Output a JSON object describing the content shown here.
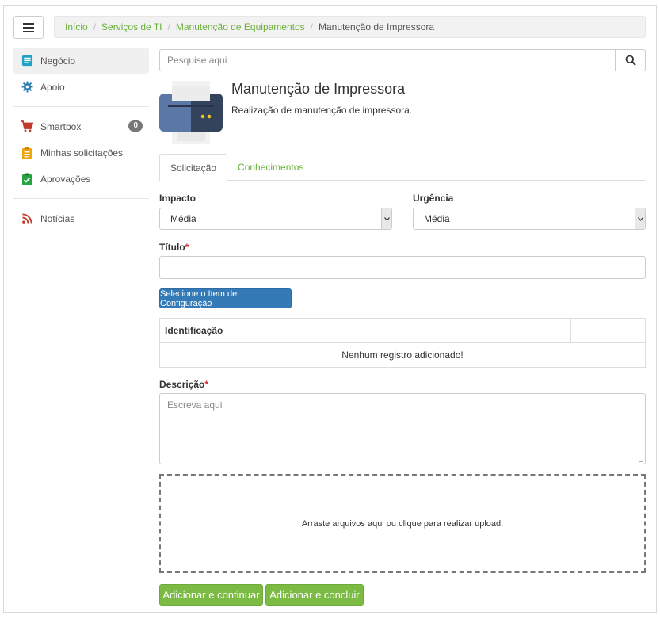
{
  "breadcrumb": {
    "items": [
      "Início",
      "Serviços de TI",
      "Manutenção de Equipamentos"
    ],
    "current": "Manutenção de Impressora"
  },
  "sidebar": {
    "items": [
      {
        "label": "Negócio",
        "icon": "newspaper-icon"
      },
      {
        "label": "Apoio",
        "icon": "gear-icon"
      },
      {
        "label": "Smartbox",
        "icon": "cart-icon",
        "badge": "0"
      },
      {
        "label": "Minhas solicitações",
        "icon": "clipboard-icon"
      },
      {
        "label": "Aprovações",
        "icon": "clipboard-check-icon"
      },
      {
        "label": "Notícias",
        "icon": "rss-icon"
      }
    ]
  },
  "search": {
    "placeholder": "Pesquise aqui"
  },
  "service": {
    "title": "Manutenção de Impressora",
    "description": "Realização de manutenção de impressora."
  },
  "tabs": [
    "Solicitação",
    "Conhecimentos"
  ],
  "form": {
    "impacto_label": "Impacto",
    "impacto_value": "Média",
    "urgencia_label": "Urgência",
    "urgencia_value": "Média",
    "titulo_label": "Título",
    "ci_button": "Selecione o Item de Configuração",
    "table_header": "Identificação",
    "table_empty": "Nenhum registro adicionado!",
    "descricao_label": "Descrição",
    "descricao_placeholder": "Escreva aqui",
    "upload_text": "Arraste arquivos aqui ou clique para realizar upload.",
    "required_mark": "*"
  },
  "actions": {
    "add_continue": "Adicionar e continuar",
    "add_finish": "Adicionar e concluir"
  },
  "colors": {
    "accent_green": "#6ab03a",
    "button_green": "#7bbb43",
    "button_blue": "#337ab7",
    "required_red": "#d9272e"
  }
}
